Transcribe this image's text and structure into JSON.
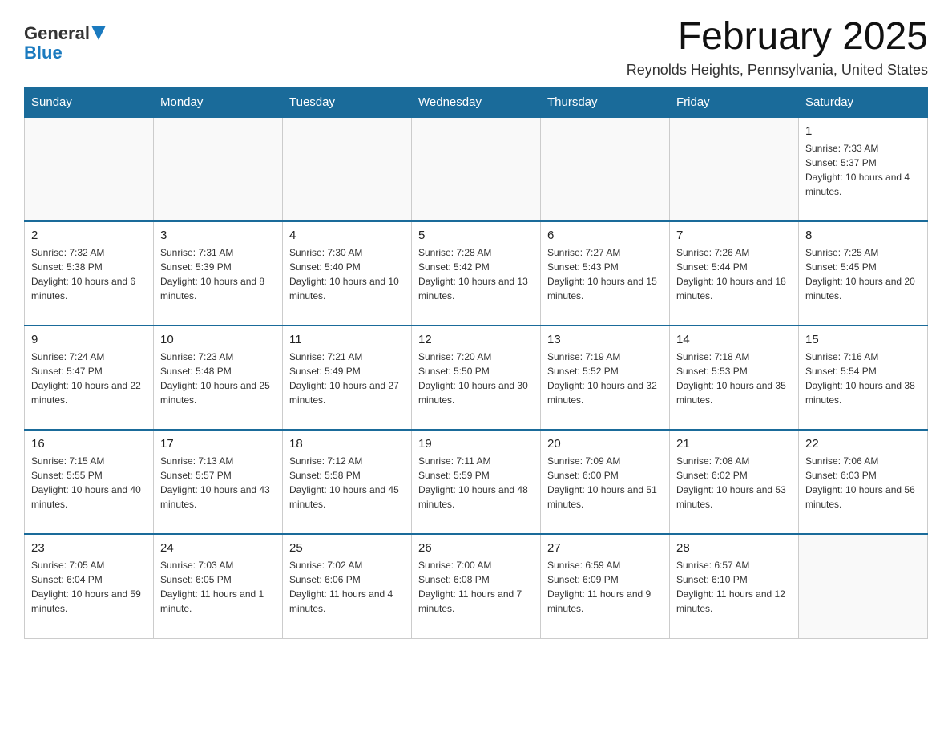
{
  "header": {
    "logo": {
      "text_general": "General",
      "text_blue": "Blue",
      "aria": "GeneralBlue logo"
    },
    "title": "February 2025",
    "subtitle": "Reynolds Heights, Pennsylvania, United States"
  },
  "calendar": {
    "days_of_week": [
      "Sunday",
      "Monday",
      "Tuesday",
      "Wednesday",
      "Thursday",
      "Friday",
      "Saturday"
    ],
    "weeks": [
      [
        {
          "day": "",
          "sunrise": "",
          "sunset": "",
          "daylight": ""
        },
        {
          "day": "",
          "sunrise": "",
          "sunset": "",
          "daylight": ""
        },
        {
          "day": "",
          "sunrise": "",
          "sunset": "",
          "daylight": ""
        },
        {
          "day": "",
          "sunrise": "",
          "sunset": "",
          "daylight": ""
        },
        {
          "day": "",
          "sunrise": "",
          "sunset": "",
          "daylight": ""
        },
        {
          "day": "",
          "sunrise": "",
          "sunset": "",
          "daylight": ""
        },
        {
          "day": "1",
          "sunrise": "Sunrise: 7:33 AM",
          "sunset": "Sunset: 5:37 PM",
          "daylight": "Daylight: 10 hours and 4 minutes."
        }
      ],
      [
        {
          "day": "2",
          "sunrise": "Sunrise: 7:32 AM",
          "sunset": "Sunset: 5:38 PM",
          "daylight": "Daylight: 10 hours and 6 minutes."
        },
        {
          "day": "3",
          "sunrise": "Sunrise: 7:31 AM",
          "sunset": "Sunset: 5:39 PM",
          "daylight": "Daylight: 10 hours and 8 minutes."
        },
        {
          "day": "4",
          "sunrise": "Sunrise: 7:30 AM",
          "sunset": "Sunset: 5:40 PM",
          "daylight": "Daylight: 10 hours and 10 minutes."
        },
        {
          "day": "5",
          "sunrise": "Sunrise: 7:28 AM",
          "sunset": "Sunset: 5:42 PM",
          "daylight": "Daylight: 10 hours and 13 minutes."
        },
        {
          "day": "6",
          "sunrise": "Sunrise: 7:27 AM",
          "sunset": "Sunset: 5:43 PM",
          "daylight": "Daylight: 10 hours and 15 minutes."
        },
        {
          "day": "7",
          "sunrise": "Sunrise: 7:26 AM",
          "sunset": "Sunset: 5:44 PM",
          "daylight": "Daylight: 10 hours and 18 minutes."
        },
        {
          "day": "8",
          "sunrise": "Sunrise: 7:25 AM",
          "sunset": "Sunset: 5:45 PM",
          "daylight": "Daylight: 10 hours and 20 minutes."
        }
      ],
      [
        {
          "day": "9",
          "sunrise": "Sunrise: 7:24 AM",
          "sunset": "Sunset: 5:47 PM",
          "daylight": "Daylight: 10 hours and 22 minutes."
        },
        {
          "day": "10",
          "sunrise": "Sunrise: 7:23 AM",
          "sunset": "Sunset: 5:48 PM",
          "daylight": "Daylight: 10 hours and 25 minutes."
        },
        {
          "day": "11",
          "sunrise": "Sunrise: 7:21 AM",
          "sunset": "Sunset: 5:49 PM",
          "daylight": "Daylight: 10 hours and 27 minutes."
        },
        {
          "day": "12",
          "sunrise": "Sunrise: 7:20 AM",
          "sunset": "Sunset: 5:50 PM",
          "daylight": "Daylight: 10 hours and 30 minutes."
        },
        {
          "day": "13",
          "sunrise": "Sunrise: 7:19 AM",
          "sunset": "Sunset: 5:52 PM",
          "daylight": "Daylight: 10 hours and 32 minutes."
        },
        {
          "day": "14",
          "sunrise": "Sunrise: 7:18 AM",
          "sunset": "Sunset: 5:53 PM",
          "daylight": "Daylight: 10 hours and 35 minutes."
        },
        {
          "day": "15",
          "sunrise": "Sunrise: 7:16 AM",
          "sunset": "Sunset: 5:54 PM",
          "daylight": "Daylight: 10 hours and 38 minutes."
        }
      ],
      [
        {
          "day": "16",
          "sunrise": "Sunrise: 7:15 AM",
          "sunset": "Sunset: 5:55 PM",
          "daylight": "Daylight: 10 hours and 40 minutes."
        },
        {
          "day": "17",
          "sunrise": "Sunrise: 7:13 AM",
          "sunset": "Sunset: 5:57 PM",
          "daylight": "Daylight: 10 hours and 43 minutes."
        },
        {
          "day": "18",
          "sunrise": "Sunrise: 7:12 AM",
          "sunset": "Sunset: 5:58 PM",
          "daylight": "Daylight: 10 hours and 45 minutes."
        },
        {
          "day": "19",
          "sunrise": "Sunrise: 7:11 AM",
          "sunset": "Sunset: 5:59 PM",
          "daylight": "Daylight: 10 hours and 48 minutes."
        },
        {
          "day": "20",
          "sunrise": "Sunrise: 7:09 AM",
          "sunset": "Sunset: 6:00 PM",
          "daylight": "Daylight: 10 hours and 51 minutes."
        },
        {
          "day": "21",
          "sunrise": "Sunrise: 7:08 AM",
          "sunset": "Sunset: 6:02 PM",
          "daylight": "Daylight: 10 hours and 53 minutes."
        },
        {
          "day": "22",
          "sunrise": "Sunrise: 7:06 AM",
          "sunset": "Sunset: 6:03 PM",
          "daylight": "Daylight: 10 hours and 56 minutes."
        }
      ],
      [
        {
          "day": "23",
          "sunrise": "Sunrise: 7:05 AM",
          "sunset": "Sunset: 6:04 PM",
          "daylight": "Daylight: 10 hours and 59 minutes."
        },
        {
          "day": "24",
          "sunrise": "Sunrise: 7:03 AM",
          "sunset": "Sunset: 6:05 PM",
          "daylight": "Daylight: 11 hours and 1 minute."
        },
        {
          "day": "25",
          "sunrise": "Sunrise: 7:02 AM",
          "sunset": "Sunset: 6:06 PM",
          "daylight": "Daylight: 11 hours and 4 minutes."
        },
        {
          "day": "26",
          "sunrise": "Sunrise: 7:00 AM",
          "sunset": "Sunset: 6:08 PM",
          "daylight": "Daylight: 11 hours and 7 minutes."
        },
        {
          "day": "27",
          "sunrise": "Sunrise: 6:59 AM",
          "sunset": "Sunset: 6:09 PM",
          "daylight": "Daylight: 11 hours and 9 minutes."
        },
        {
          "day": "28",
          "sunrise": "Sunrise: 6:57 AM",
          "sunset": "Sunset: 6:10 PM",
          "daylight": "Daylight: 11 hours and 12 minutes."
        },
        {
          "day": "",
          "sunrise": "",
          "sunset": "",
          "daylight": ""
        }
      ]
    ]
  }
}
